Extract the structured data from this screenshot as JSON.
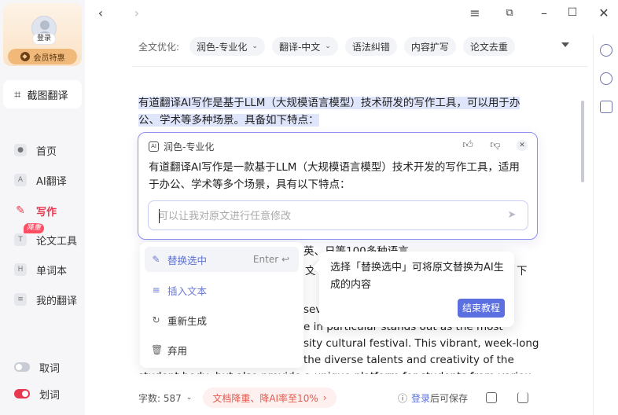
{
  "sidebar": {
    "login_label": "登录",
    "vip_label": "会员特惠",
    "capture_label": "截图翻译",
    "items": [
      {
        "label": "首页",
        "icon": "home-icon"
      },
      {
        "label": "AI翻译",
        "icon": "ai-translate-icon"
      },
      {
        "label": "写作",
        "icon": "pen-icon"
      },
      {
        "label": "论文工具",
        "icon": "thesis-tool-icon"
      },
      {
        "label": "单词本",
        "icon": "wordbook-icon"
      },
      {
        "label": "我的翻译",
        "icon": "my-translation-icon"
      }
    ],
    "new_badge": "降重",
    "toggles": [
      {
        "label": "取词",
        "on": false
      },
      {
        "label": "划词",
        "on": true
      }
    ]
  },
  "toolbar": {
    "label": "全文优化:",
    "chips": [
      "润色-专业化",
      "翻译-中文",
      "语法纠错",
      "内容扩写",
      "论文去重"
    ]
  },
  "doc": {
    "selected_text": "有道翻译AI写作是基于LLM（大规模语言模型）技术研发的写作工具，可以用于办公、学术等多种场景。具备如下特点：",
    "hidden_fragments": [
      "英、日等100多种语言",
      "文",
      "下",
      "seve",
      "e in particular stands out as the most",
      "sity cultural festival. This vibrant, week-long",
      "the diverse talents and creativity of the",
      "student body, but also provide a unique platform for students from various"
    ]
  },
  "popup": {
    "mode": "润色-专业化",
    "result": "有道翻译AI写作是一款基于LLM（大规模语言模型）技术开发的写作工具，适用于办公、学术等多个场景，具有以下特点：",
    "input_placeholder": "可以让我对原文进行任意修改"
  },
  "menu": {
    "items": [
      {
        "label": "替换选中",
        "shortcut": "Enter ↩",
        "icon": "replace-icon"
      },
      {
        "label": "插入文本",
        "icon": "insert-icon"
      },
      {
        "label": "重新生成",
        "icon": "regenerate-icon"
      },
      {
        "label": "弃用",
        "icon": "trash-icon"
      }
    ]
  },
  "tip": {
    "text": "选择「替换选中」可将原文替换为AI生成的内容",
    "button": "结束教程"
  },
  "bottom": {
    "word_count_label": "字数: 587",
    "promo": "文档降重、降AI率至10%",
    "save_link": "登录",
    "save_rest": "后可保存"
  },
  "colors": {
    "accent": "#5b6fe0",
    "brand_red": "#e8384f",
    "selection": "#dfe5fb"
  }
}
